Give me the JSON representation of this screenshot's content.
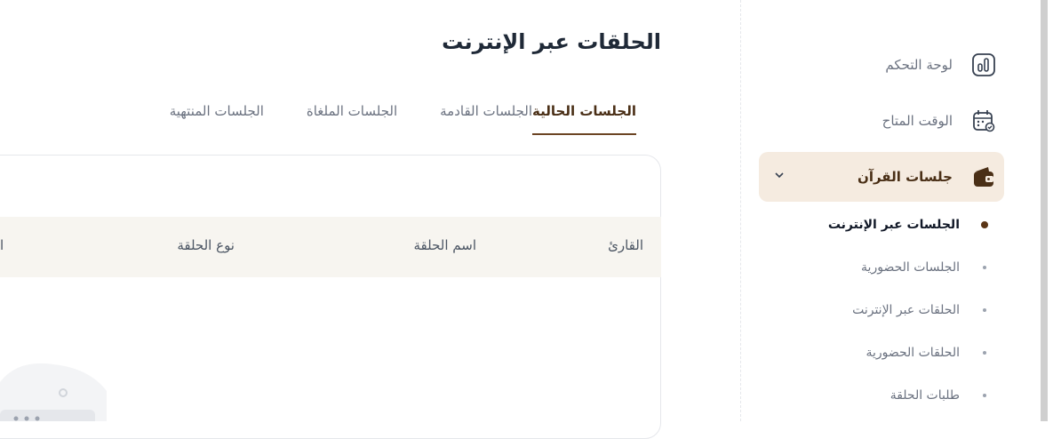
{
  "page": {
    "title": "الحلقات عبر الإنترنت"
  },
  "tabs": [
    {
      "label": "الجلسات الحالية",
      "active": true
    },
    {
      "label": "الجلسات القادمة",
      "active": false
    },
    {
      "label": "الجلسات الملغاة",
      "active": false
    },
    {
      "label": "الجلسات المنتهية",
      "active": false
    }
  ],
  "table": {
    "columns": [
      "القارئ",
      "اسم الحلقة",
      "نوع الحلقة",
      "ا"
    ]
  },
  "sidebar": {
    "items": [
      {
        "label": "لوحة التحكم",
        "icon": "chart-bars-icon"
      },
      {
        "label": "الوقت المتاح",
        "icon": "calendar-check-icon"
      },
      {
        "label": "جلسات القرآن",
        "icon": "wallet-icon",
        "expanded": true
      }
    ],
    "subitems": [
      {
        "label": "الجلسات عبر الإنترنت",
        "current": true
      },
      {
        "label": "الجلسات الحضورية",
        "current": false
      },
      {
        "label": "الحلقات عبر الإنترنت",
        "current": false
      },
      {
        "label": "الحلقات الحضورية",
        "current": false
      },
      {
        "label": "طلبات الحلقة",
        "current": false
      }
    ]
  },
  "colors": {
    "accent": "#6b4423",
    "accent_bg": "#f5ebe0",
    "table_header_bg": "#f7f5f0"
  }
}
